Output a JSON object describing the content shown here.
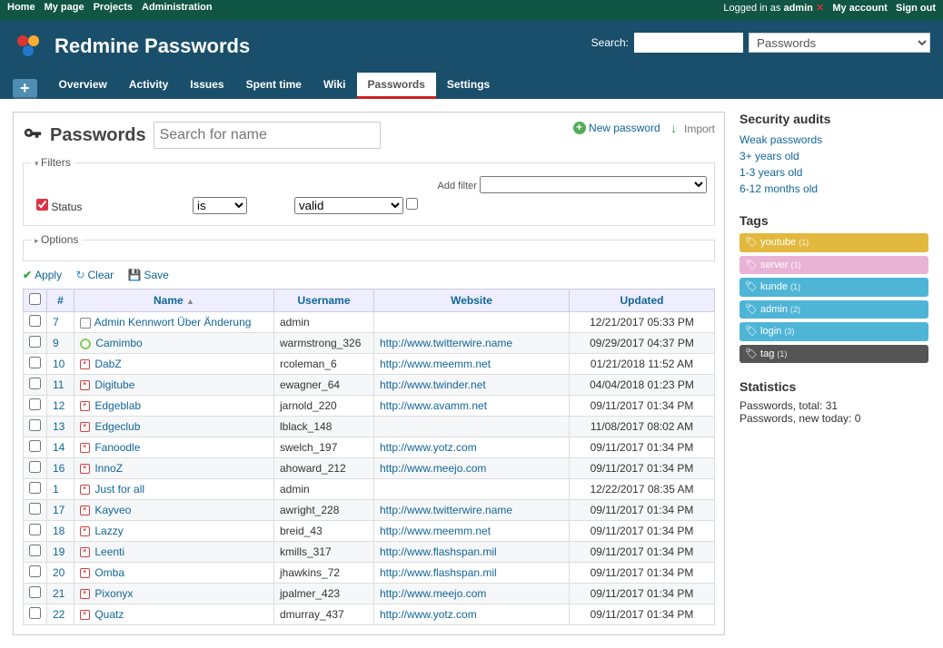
{
  "top": {
    "left": [
      "Home",
      "My page",
      "Projects",
      "Administration"
    ],
    "logged_prefix": "Logged in as ",
    "logged_user": "admin",
    "right": [
      "My account",
      "Sign out"
    ]
  },
  "header": {
    "title": "Redmine Passwords",
    "search_label": "Search:",
    "jump_selected": "Passwords",
    "tabs": [
      "Overview",
      "Activity",
      "Issues",
      "Spent time",
      "Wiki",
      "Passwords",
      "Settings"
    ],
    "active_tab": "Passwords",
    "new_object": "+"
  },
  "page": {
    "heading": "Passwords",
    "search_placeholder": "Search for name",
    "contextual": {
      "new": "New password",
      "import": "Import"
    },
    "filters_legend": "Filters",
    "options_legend": "Options",
    "add_filter_label": "Add filter",
    "status_label": "Status",
    "status_op": "is",
    "status_val": "valid",
    "apply": "Apply",
    "clear": "Clear",
    "save": "Save",
    "cols": {
      "num": "#",
      "name": "Name",
      "user": "Username",
      "web": "Website",
      "upd": "Updated"
    }
  },
  "rows": [
    {
      "id": "7",
      "icon": "cat",
      "name": "Admin Kennwort Über Änderung",
      "user": "admin",
      "web": "",
      "upd": "12/21/2017 05:33 PM"
    },
    {
      "id": "9",
      "icon": "recycle",
      "name": "Camimbo",
      "user": "warmstrong_326",
      "web": "http://www.twitterwire.name",
      "upd": "09/29/2017 04:37 PM"
    },
    {
      "id": "10",
      "icon": "pw",
      "name": "DabZ",
      "user": "rcoleman_6",
      "web": "http://www.meemm.net",
      "upd": "01/21/2018 11:52 AM"
    },
    {
      "id": "11",
      "icon": "pw",
      "name": "Digitube",
      "user": "ewagner_64",
      "web": "http://www.twinder.net",
      "upd": "04/04/2018 01:23 PM"
    },
    {
      "id": "12",
      "icon": "pw",
      "name": "Edgeblab",
      "user": "jarnold_220",
      "web": "http://www.avamm.net",
      "upd": "09/11/2017 01:34 PM"
    },
    {
      "id": "13",
      "icon": "pw",
      "name": "Edgeclub",
      "user": "lblack_148",
      "web": "",
      "upd": "11/08/2017 08:02 AM"
    },
    {
      "id": "14",
      "icon": "pw",
      "name": "Fanoodle",
      "user": "swelch_197",
      "web": "http://www.yotz.com",
      "upd": "09/11/2017 01:34 PM"
    },
    {
      "id": "16",
      "icon": "pw",
      "name": "InnoZ",
      "user": "ahoward_212",
      "web": "http://www.meejo.com",
      "upd": "09/11/2017 01:34 PM"
    },
    {
      "id": "1",
      "icon": "pw",
      "name": "Just for all",
      "user": "admin",
      "web": "",
      "upd": "12/22/2017 08:35 AM"
    },
    {
      "id": "17",
      "icon": "pw",
      "name": "Kayveo",
      "user": "awright_228",
      "web": "http://www.twitterwire.name",
      "upd": "09/11/2017 01:34 PM"
    },
    {
      "id": "18",
      "icon": "pw",
      "name": "Lazzy",
      "user": "breid_43",
      "web": "http://www.meemm.net",
      "upd": "09/11/2017 01:34 PM"
    },
    {
      "id": "19",
      "icon": "pw",
      "name": "Leenti",
      "user": "kmills_317",
      "web": "http://www.flashspan.mil",
      "upd": "09/11/2017 01:34 PM"
    },
    {
      "id": "20",
      "icon": "pw",
      "name": "Omba",
      "user": "jhawkins_72",
      "web": "http://www.flashspan.mil",
      "upd": "09/11/2017 01:34 PM"
    },
    {
      "id": "21",
      "icon": "pw",
      "name": "Pixonyx",
      "user": "jpalmer_423",
      "web": "http://www.meejo.com",
      "upd": "09/11/2017 01:34 PM"
    },
    {
      "id": "22",
      "icon": "pw",
      "name": "Quatz",
      "user": "dmurray_437",
      "web": "http://www.yotz.com",
      "upd": "09/11/2017 01:34 PM"
    }
  ],
  "sidebar": {
    "audits_h": "Security audits",
    "audits": [
      "Weak passwords",
      "3+ years old",
      "1-3 years old",
      "6-12 months old"
    ],
    "tags_h": "Tags",
    "tags": [
      {
        "name": "youtube",
        "cnt": 1,
        "cls": "youtube"
      },
      {
        "name": "server",
        "cnt": 1,
        "cls": "server"
      },
      {
        "name": "kunde",
        "cnt": 1,
        "cls": "kunde"
      },
      {
        "name": "admin",
        "cnt": 2,
        "cls": "admin"
      },
      {
        "name": "login",
        "cnt": 3,
        "cls": "login"
      },
      {
        "name": "tag",
        "cnt": 1,
        "cls": "tag"
      }
    ],
    "stats_h": "Statistics",
    "stats": [
      "Passwords, total: 31",
      "Passwords, new today: 0"
    ]
  }
}
